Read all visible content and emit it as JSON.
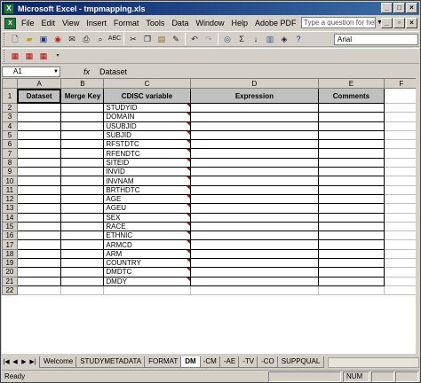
{
  "window": {
    "title": "Microsoft Excel - tmpmapping.xls",
    "app_icon": "excel-icon"
  },
  "menu": {
    "items": [
      "File",
      "Edit",
      "View",
      "Insert",
      "Format",
      "Tools",
      "Data",
      "Window",
      "Help",
      "Adobe PDF"
    ],
    "help_placeholder": "Type a question for help"
  },
  "toolbar": {
    "font_name": "Arial"
  },
  "formula_bar": {
    "name_box": "A1",
    "fx": "fx",
    "value": "Dataset"
  },
  "sheet": {
    "column_headers": [
      "A",
      "B",
      "C",
      "D",
      "E",
      "F"
    ],
    "header_row": {
      "row": "1",
      "cells": [
        "Dataset",
        "Merge Key",
        "CDISC variable",
        "Expression",
        "Comments"
      ]
    },
    "rows": [
      {
        "row": "2",
        "cdisc": "STUDYID"
      },
      {
        "row": "3",
        "cdisc": "DOMAIN"
      },
      {
        "row": "4",
        "cdisc": "USUBJID"
      },
      {
        "row": "5",
        "cdisc": "SUBJID"
      },
      {
        "row": "6",
        "cdisc": "RFSTDTC"
      },
      {
        "row": "7",
        "cdisc": "RFENDTC"
      },
      {
        "row": "8",
        "cdisc": "SITEID"
      },
      {
        "row": "9",
        "cdisc": "INVID"
      },
      {
        "row": "10",
        "cdisc": "INVNAM"
      },
      {
        "row": "11",
        "cdisc": "BRTHDTC"
      },
      {
        "row": "12",
        "cdisc": "AGE"
      },
      {
        "row": "13",
        "cdisc": "AGEU"
      },
      {
        "row": "14",
        "cdisc": "SEX"
      },
      {
        "row": "15",
        "cdisc": "RACE"
      },
      {
        "row": "16",
        "cdisc": "ETHNIC"
      },
      {
        "row": "17",
        "cdisc": "ARMCD"
      },
      {
        "row": "18",
        "cdisc": "ARM"
      },
      {
        "row": "19",
        "cdisc": "COUNTRY"
      },
      {
        "row": "20",
        "cdisc": "DMDTC"
      },
      {
        "row": "21",
        "cdisc": "DMDY"
      }
    ],
    "extra_row": "22"
  },
  "tabs": [
    "Welcome",
    "STUDYMETADATA",
    "FORMAT",
    "DM",
    "-CM",
    "-AE",
    "-TV",
    "-CO",
    "SUPPQUAL"
  ],
  "active_tab": "DM",
  "status": {
    "ready": "Ready",
    "num": "NUM"
  }
}
